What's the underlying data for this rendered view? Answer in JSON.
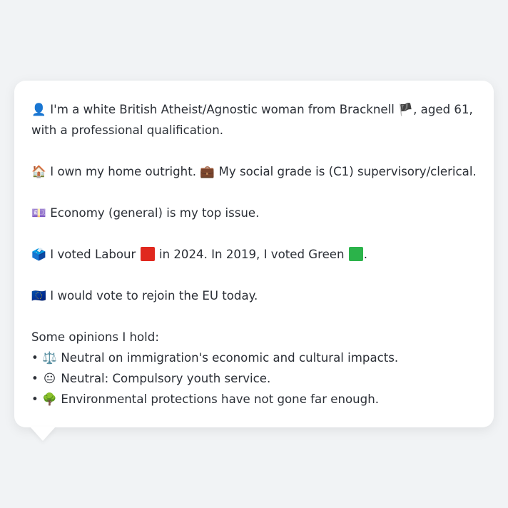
{
  "profile": {
    "intro": {
      "icon": "👤",
      "text1": "I'm a white British Atheist/Agnostic woman from Bracknell",
      "flag": "🏴",
      "text2": ", aged 61,",
      "text3": "with a professional qualification."
    },
    "home": {
      "icon": "🏠",
      "text1": "I own my home outright.",
      "icon2": "💼",
      "text2": "My social grade is (C1) supervisory/clerical."
    },
    "issue": {
      "icon": "💷",
      "text": "Economy (general) is my top issue."
    },
    "vote": {
      "icon": "🗳️",
      "text1": "I voted Labour",
      "labour_color": "#e0281e",
      "text2": "in 2024. In 2019, I voted Green",
      "green_color": "#2bb34a",
      "text3": "."
    },
    "eu": {
      "icon": "🇪🇺",
      "text": "I would vote to rejoin the EU today."
    },
    "opinions": {
      "heading": "Some opinions I hold:",
      "items": [
        {
          "bullet": "•",
          "icon": "⚖️",
          "text": "Neutral on immigration's economic and cultural impacts."
        },
        {
          "bullet": "•",
          "icon": "😐",
          "text": "Neutral: Compulsory youth service."
        },
        {
          "bullet": "•",
          "icon": "🌳",
          "text": "Environmental protections have not gone far enough."
        }
      ]
    }
  }
}
